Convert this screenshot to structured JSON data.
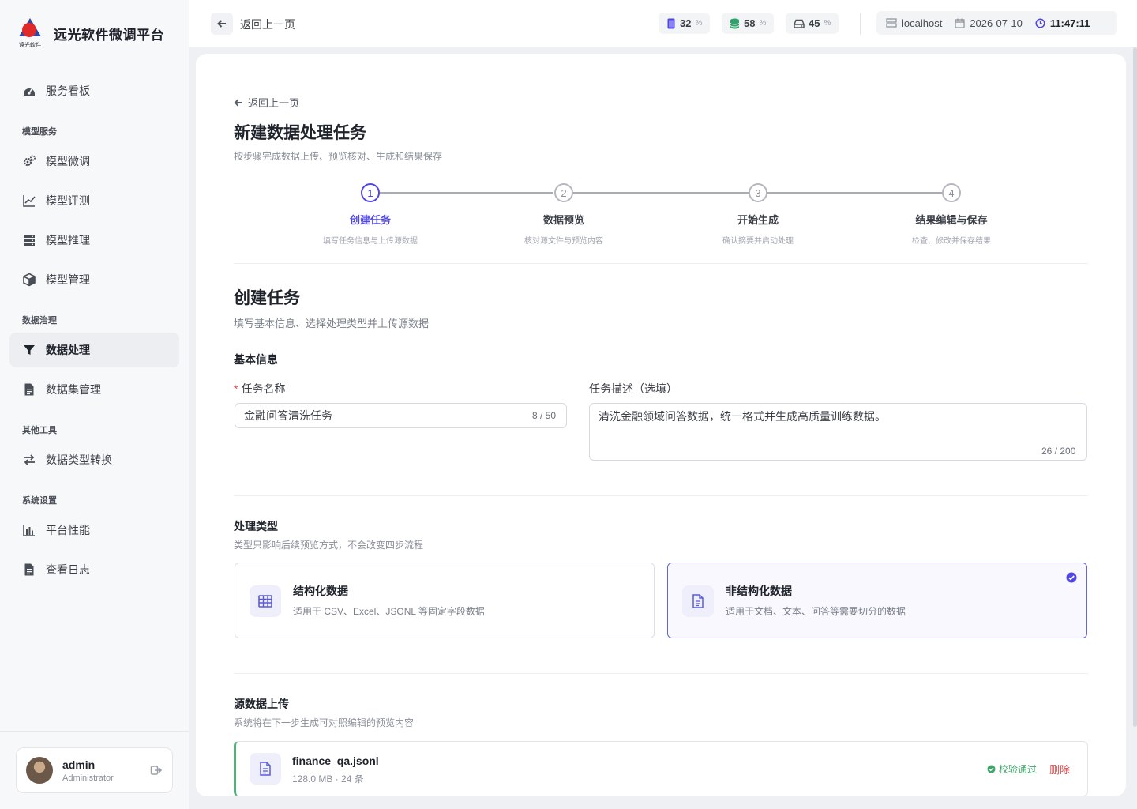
{
  "brand": {
    "title": "远光软件微调平台",
    "logo_text": "遠光軟件"
  },
  "sidebar": {
    "dashboard": "服务看板",
    "groups": {
      "model": "模型服务",
      "data": "数据治理",
      "tools": "其他工具",
      "system": "系统设置"
    },
    "items": {
      "finetune": "模型微调",
      "eval": "模型评测",
      "inference": "模型推理",
      "manage": "模型管理",
      "processing": "数据处理",
      "datasets": "数据集管理",
      "convert": "数据类型转换",
      "performance": "平台性能",
      "logs": "查看日志"
    },
    "user": {
      "name": "admin",
      "role": "Administrator"
    }
  },
  "topbar": {
    "back_label": "返回上一页",
    "stats": {
      "gpu": 32,
      "db": 58,
      "disk": 45,
      "unit": "%"
    },
    "host": "localhost",
    "date": "2026-07-10",
    "time": "11:47:11"
  },
  "page": {
    "back_label": "返回上一页",
    "title": "新建数据处理任务",
    "subtitle": "按步骤完成数据上传、预览核对、生成和结果保存",
    "current_step": 1,
    "steps": [
      {
        "num": "1",
        "title": "创建任务",
        "desc": "填写任务信息与上传源数据"
      },
      {
        "num": "2",
        "title": "数据预览",
        "desc": "核对源文件与预览内容"
      },
      {
        "num": "3",
        "title": "开始生成",
        "desc": "确认摘要并启动处理"
      },
      {
        "num": "4",
        "title": "结果编辑与保存",
        "desc": "检查、修改并保存结果"
      }
    ]
  },
  "form": {
    "section_title": "创建任务",
    "section_subtitle": "填写基本信息、选择处理类型并上传源数据",
    "basic_title": "基本信息",
    "name_required_mark": "*",
    "name_label": "任务名称",
    "name_value": "金融问答清洗任务",
    "name_counter": "8 / 50",
    "desc_label": "任务描述（选填）",
    "desc_value": "清洗金融领域问答数据，统一格式并生成高质量训练数据。",
    "desc_counter": "26 / 200",
    "type_title": "处理类型",
    "type_hint": "类型只影响后续预览方式，不会改变四步流程",
    "types": [
      {
        "title": "结构化数据",
        "desc": "适用于 CSV、Excel、JSONL 等固定字段数据",
        "selected": false
      },
      {
        "title": "非结构化数据",
        "desc": "适用于文档、文本、问答等需要切分的数据",
        "selected": true
      }
    ],
    "upload_title": "源数据上传",
    "upload_hint": "系统将在下一步生成可对照编辑的预览内容",
    "file": {
      "name": "finance_qa.jsonl",
      "meta": "128.0 MB · 24 条",
      "status": "校验通过",
      "delete_label": "删除"
    }
  },
  "colors": {
    "accent": "#4f46e5",
    "success": "#3fa46a",
    "danger": "#e5484d"
  }
}
